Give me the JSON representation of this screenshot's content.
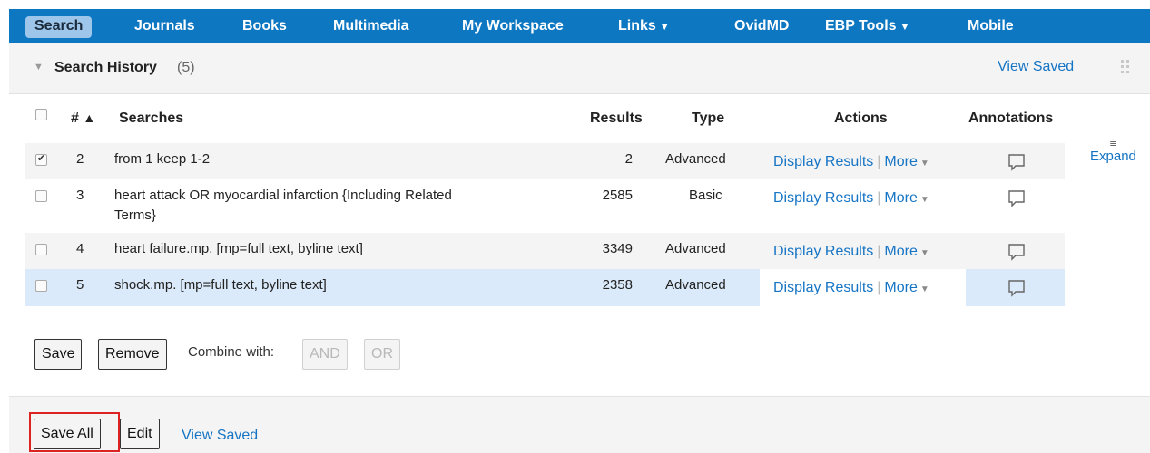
{
  "nav": {
    "items": [
      {
        "label": "Search",
        "active": true
      },
      {
        "label": "Journals"
      },
      {
        "label": "Books"
      },
      {
        "label": "Multimedia"
      },
      {
        "label": "My Workspace"
      },
      {
        "label": "Links",
        "caret": "▼"
      },
      {
        "label": "OvidMD"
      },
      {
        "label": "EBP Tools",
        "caret": "▼"
      },
      {
        "label": "Mobile"
      }
    ]
  },
  "history": {
    "title": "Search History",
    "count": "(5)",
    "view_saved": "View Saved",
    "headers": {
      "num": "#",
      "sort_indicator": "▲",
      "searches": "Searches",
      "results": "Results",
      "type": "Type",
      "actions": "Actions",
      "annotations": "Annotations"
    },
    "rows": [
      {
        "num": "2",
        "search": "from 1 keep 1-2",
        "results": "2",
        "type": "Advanced",
        "checked": true
      },
      {
        "num": "3",
        "search": "heart attack OR myocardial infarction {Including Related",
        "search_line2": "Terms}",
        "results": "2585",
        "type": "Basic",
        "checked": false
      },
      {
        "num": "4",
        "search": "heart failure.mp. [mp=full text, byline text]",
        "results": "3349",
        "type": "Advanced",
        "checked": false
      },
      {
        "num": "5",
        "search": "shock.mp. [mp=full text, byline text]",
        "results": "2358",
        "type": "Advanced",
        "checked": false
      }
    ],
    "action_display": "Display Results",
    "action_more": "More",
    "expand_label": "Expand"
  },
  "controls": {
    "save": "Save",
    "remove": "Remove",
    "combine_with": "Combine with:",
    "and": "AND",
    "or": "OR"
  },
  "footer": {
    "save_all": "Save All",
    "edit": "Edit",
    "view_saved": "View Saved"
  },
  "icons": {
    "expand": "expand-icon",
    "annotation": "comment-icon",
    "collapse": "triangle-down-icon",
    "grip": "drag-grip-icon"
  },
  "colors": {
    "nav_bg": "#0e77c2",
    "link": "#1574c4",
    "selected_row": "#dbeafa",
    "highlight": "#dd2222"
  }
}
